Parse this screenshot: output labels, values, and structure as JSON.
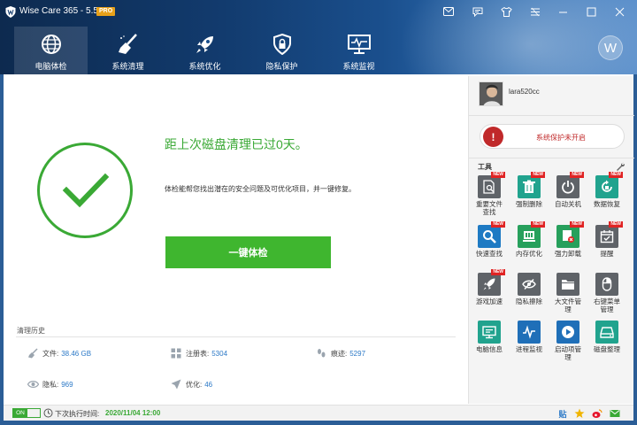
{
  "app": {
    "title": "Wise Care 365 - 5.5.9",
    "badge": "PRO"
  },
  "nav": [
    {
      "label": "电脑体检",
      "icon": "globe-icon",
      "active": true
    },
    {
      "label": "系统清理",
      "icon": "broom-icon"
    },
    {
      "label": "系统优化",
      "icon": "rocket-icon"
    },
    {
      "label": "隐私保护",
      "icon": "shield-lock-icon"
    },
    {
      "label": "系统监视",
      "icon": "monitor-icon"
    }
  ],
  "account": {
    "avatar_letter": "W"
  },
  "main": {
    "headline": "距上次磁盘清理已过0天。",
    "subtext": "体检能帮您找出潜在的安全问题及可优化项目，并一键修复。",
    "scan_button": "一键体检"
  },
  "history": {
    "title": "清理历史",
    "stats": [
      {
        "label": "文件:",
        "value": "38.46 GB",
        "icon": "broom-icon"
      },
      {
        "label": "注册表:",
        "value": "5304",
        "icon": "registry-icon"
      },
      {
        "label": "痕迹:",
        "value": "5297",
        "icon": "footprints-icon"
      },
      {
        "label": "隐私:",
        "value": "969",
        "icon": "eye-icon"
      },
      {
        "label": "优化:",
        "value": "46",
        "icon": "plane-icon"
      }
    ]
  },
  "user": {
    "name": "lara520cc"
  },
  "protection": {
    "status": "系统保护未开启",
    "color": "#c0292a"
  },
  "tools": {
    "title": "工具",
    "items": [
      {
        "label": "重要文件\n查找",
        "icon": "file-search-icon",
        "color": "gray",
        "new": true
      },
      {
        "label": "强制删除",
        "icon": "trash-icon",
        "color": "teal",
        "new": true
      },
      {
        "label": "自动关机",
        "icon": "power-icon",
        "color": "gray",
        "new": true
      },
      {
        "label": "数据恢复",
        "icon": "recover-icon",
        "color": "teal",
        "new": true
      },
      {
        "label": "快速查找",
        "icon": "search-icon",
        "color": "blue",
        "new": true
      },
      {
        "label": "内存优化",
        "icon": "memory-icon",
        "color": "green",
        "new": true
      },
      {
        "label": "强力卸载",
        "icon": "uninstall-icon",
        "color": "green",
        "new": true
      },
      {
        "label": "提醒",
        "icon": "calendar-icon",
        "color": "gray",
        "new": true
      },
      {
        "label": "游戏加速",
        "icon": "rocket-icon",
        "color": "gray",
        "new": true
      },
      {
        "label": "隐私擦除",
        "icon": "eye-slash-icon",
        "color": "gray"
      },
      {
        "label": "大文件管\n理",
        "icon": "folder-icon",
        "color": "gray"
      },
      {
        "label": "右键菜单\n管理",
        "icon": "mouse-icon",
        "color": "gray"
      },
      {
        "label": "电脑信息",
        "icon": "pc-info-icon",
        "color": "teal"
      },
      {
        "label": "进程监视",
        "icon": "pulse-icon",
        "color": "dblue"
      },
      {
        "label": "启动项管\n理",
        "icon": "play-icon",
        "color": "dblue"
      },
      {
        "label": "磁盘整理",
        "icon": "disk-icon",
        "color": "teal"
      }
    ],
    "new_tag": "NEW"
  },
  "statusbar": {
    "toggle": "ON",
    "label": "下次执行时间:",
    "time": "2020/11/04 12:00",
    "right_text": "贴"
  },
  "colors": {
    "accent_green": "#3aa935",
    "link_blue": "#2c79c7",
    "header": "#123b6e"
  }
}
